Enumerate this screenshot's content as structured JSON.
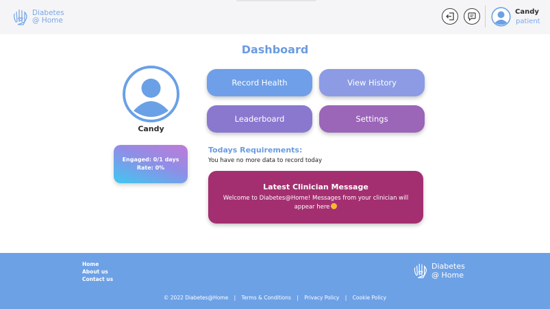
{
  "header": {
    "logo_line1": "Diabetes",
    "logo_line2": "@ Home",
    "logout_icon": "logout-icon",
    "message_icon": "chat-icon",
    "user_name": "Candy",
    "user_role": "patient"
  },
  "main": {
    "title": "Dashboard",
    "profile_name": "Candy",
    "stats": {
      "engaged": "Engaged: 0/1 days",
      "rate": "Rate: 0%"
    },
    "buttons": {
      "record_health": "Record Health",
      "view_history": "View History",
      "leaderboard": "Leaderboard",
      "settings": "Settings"
    },
    "requirements": {
      "title": "Todays Requirements:",
      "text": "You have no more data to record today"
    },
    "message": {
      "title": "Latest Clinician Message",
      "body": "Welcome to Diabetes@Home! Messages from your clinician will appear here"
    }
  },
  "footer": {
    "links": [
      "Home",
      "About us",
      "Contact us"
    ],
    "logo_line1": "Diabetes",
    "logo_line2": "@ Home",
    "copyright": "© 2022 Diabetes@Home",
    "separator": "|",
    "terms": "Terms & Conditions",
    "privacy": "Privacy Policy",
    "cookie": "Cookie Policy"
  },
  "colors": {
    "accent": "#6a9be0",
    "footer": "#6da1e6",
    "message_card": "#a32f70"
  }
}
